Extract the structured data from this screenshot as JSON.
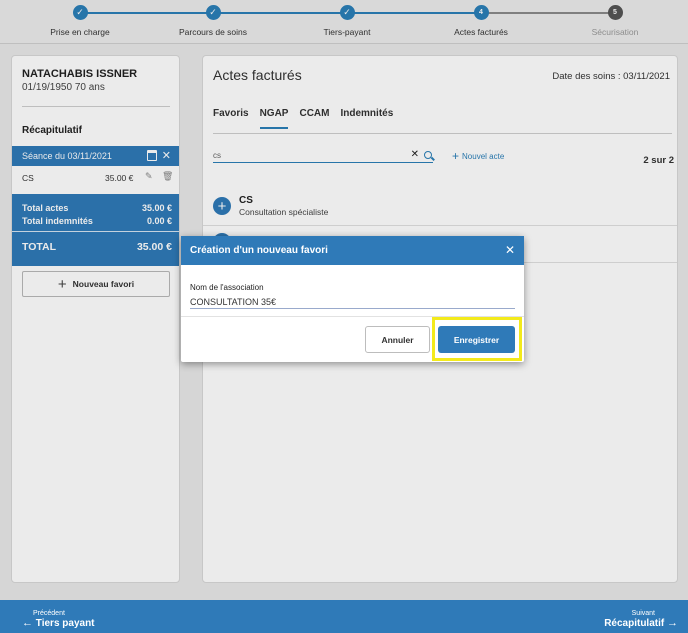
{
  "stepper": {
    "steps": [
      {
        "label": "Prise en charge",
        "state": "done",
        "marker": "✓"
      },
      {
        "label": "Parcours de soins",
        "state": "done",
        "marker": "✓"
      },
      {
        "label": "Tiers-payant",
        "state": "done",
        "marker": "✓"
      },
      {
        "label": "Actes facturés",
        "state": "current",
        "marker": "4"
      },
      {
        "label": "Sécurisation",
        "state": "todo",
        "marker": "5"
      }
    ]
  },
  "patient": {
    "name": "NATACHABIS ISSNER",
    "info": "01/19/1950 70 ans"
  },
  "summary": {
    "title": "Récapitulatif",
    "session_label": "Séance du 03/11/2021",
    "acts": [
      {
        "code": "CS",
        "price": "35.00 €"
      }
    ],
    "total_acts_label": "Total actes",
    "total_acts_value": "35.00 €",
    "total_allowances_label": "Total indemnités",
    "total_allowances_value": "0.00 €",
    "total_label": "TOTAL",
    "total_value": "35.00 €",
    "new_favorite_label": "Nouveau favori"
  },
  "main": {
    "title": "Actes facturés",
    "date_label": "Date des soins : 03/11/2021",
    "tabs": [
      "Favoris",
      "NGAP",
      "CCAM",
      "Indemnités"
    ],
    "active_tab": "NGAP",
    "search_value": "cs",
    "new_act_label": "Nouvel acte",
    "result_count": "2 sur 2",
    "results": [
      {
        "code": "CS",
        "desc": "Consultation spécialiste"
      }
    ]
  },
  "modal": {
    "title": "Création d'un nouveau favori",
    "field_label": "Nom de l'association",
    "field_value": "CONSULTATION 35€",
    "cancel_label": "Annuler",
    "save_label": "Enregistrer"
  },
  "footer": {
    "prev_small": "Précédent",
    "prev_label": "Tiers payant",
    "next_small": "Suivant",
    "next_label": "Récapitulatif"
  },
  "colors": {
    "primary": "#2f7ab8",
    "highlight": "#f3ea1b"
  }
}
